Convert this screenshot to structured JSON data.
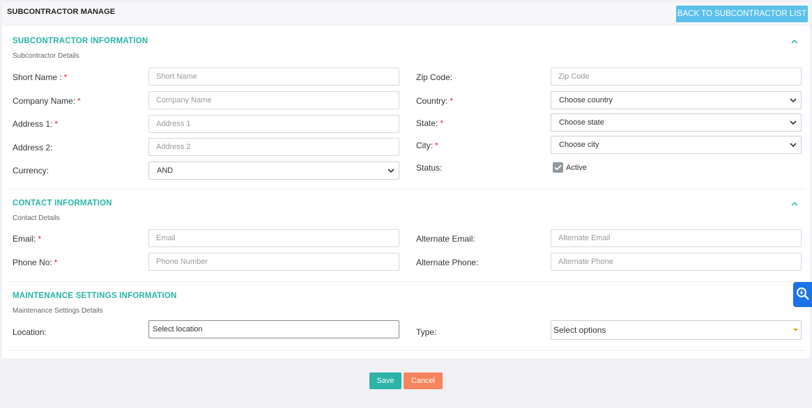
{
  "header": {
    "title": "SUBCONTRACTOR MANAGE",
    "back_button": "BACK TO SUBCONTRACTOR LIST"
  },
  "subcontractor_info": {
    "title": "SUBCONTRACTOR INFORMATION",
    "subtitle": "Subcontractor Details",
    "short_name_label": "Short Name :",
    "short_name_placeholder": "Short Name",
    "company_name_label": "Company Name:",
    "company_name_placeholder": "Company Name",
    "address1_label": "Address 1:",
    "address1_placeholder": "Address 1",
    "address2_label": "Address 2:",
    "address2_placeholder": "Address 2",
    "currency_label": "Currency:",
    "currency_value": "AND",
    "zip_label": "Zip Code:",
    "zip_placeholder": "Zip Code",
    "country_label": "Country:",
    "country_value": "Choose country",
    "state_label": "State:",
    "state_value": "Choose state",
    "city_label": "City:",
    "city_value": "Choose city",
    "status_label": "Status:",
    "status_checkbox_label": "Active",
    "required_mark": "*"
  },
  "contact_info": {
    "title": "CONTACT INFORMATION",
    "subtitle": "Contact Details",
    "email_label": "Email:",
    "email_placeholder": "Email",
    "phone_label": "Phone No:",
    "phone_placeholder": "Phone Number",
    "alt_email_label": "Alternate Email:",
    "alt_email_placeholder": "Alternate Email",
    "alt_phone_label": "Alternate Phone:",
    "alt_phone_placeholder": "Alternate Phone"
  },
  "maintenance_info": {
    "title": "MAINTENANCE SETTINGS INFORMATION",
    "subtitle": "Maintenance Settings Details",
    "location_label": "Location:",
    "location_value": "Select location",
    "type_label": "Type:",
    "type_value": "Select options"
  },
  "footer": {
    "save_label": "Save",
    "cancel_label": "Cancel"
  },
  "colors": {
    "accent": "#2ab3a6",
    "back_button": "#5bc0eb",
    "cancel": "#f7845e",
    "required": "#d9262c",
    "help_widget": "#1a73e8"
  },
  "icons": [
    "chevron-up-icon",
    "chevron-down-icon",
    "checkmark-icon",
    "caret-down-icon",
    "search-help-icon"
  ]
}
